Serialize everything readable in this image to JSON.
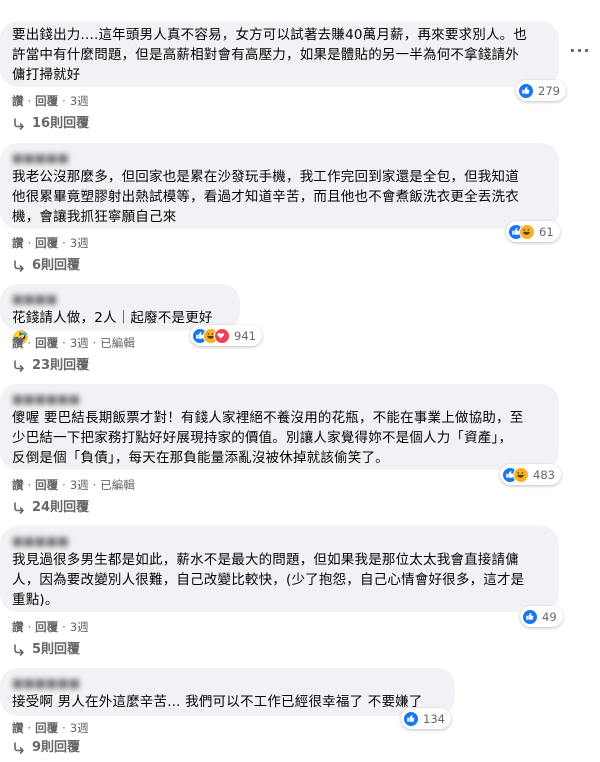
{
  "comments": [
    {
      "author": "",
      "lines": [
        "要出錢出力....這年頭男人真不容易，女方可以試著去賺40萬月薪，再來要求別人。也",
        "許當中有什麼問題，但是高薪相對會有高壓力，如果是體貼的另一半為何不拿錢請外",
        "傭打掃就好"
      ],
      "actions": [
        "讚",
        "回覆",
        "3週"
      ],
      "reaction_count": "279",
      "reaction_icons": [
        "like-icon"
      ],
      "replies": "16則回覆"
    },
    {
      "author": "",
      "lines": [
        "我老公沒那麼多，但回家也是累在沙發玩手機，我工作完回到家還是全包，但我知道",
        "他很累畢竟塑膠射出熱試模等，看過才知道辛苦，而且他也不會煮飯洗衣更全丟洗衣",
        "機，會讓我抓狂寧願自己來"
      ],
      "actions": [
        "讚",
        "回覆",
        "3週"
      ],
      "reaction_count": "61",
      "reaction_icons": [
        "like-icon",
        "haha-icon"
      ],
      "replies": "6則回覆"
    },
    {
      "author": "",
      "lines": [
        "花錢請人做，2人｜起廢不是更好🤣"
      ],
      "actions": [
        "讚",
        "回覆",
        "3週",
        "已編輯"
      ],
      "reaction_count": "941",
      "reaction_icons": [
        "like-icon",
        "haha-icon",
        "love-icon"
      ],
      "replies": "23則回覆"
    },
    {
      "author": "",
      "lines": [
        "傻喔 要巴結長期飯票才對！有錢人家裡絕不養沒用的花瓶，不能在事業上做協助，至",
        "少巴結一下把家務打點好好展現持家的價值。別讓人家覺得妳不是個人力「資產」，",
        "反倒是個「負債」，每天在那負能量添亂沒被休掉就該偷笑了。"
      ],
      "actions": [
        "讚",
        "回覆",
        "3週",
        "已編輯"
      ],
      "reaction_count": "483",
      "reaction_icons": [
        "like-icon",
        "haha-icon"
      ],
      "replies": "24則回覆"
    },
    {
      "author": "",
      "lines": [
        "我見過很多男生都是如此，薪水不是最大的問題，但如果我是那位太太我會直接請傭",
        "人，因為要改變別人很難，自己改變比較快，(少了抱怨，自己心情會好很多，這才是",
        "重點)。"
      ],
      "actions": [
        "讚",
        "回覆",
        "3週"
      ],
      "reaction_count": "49",
      "reaction_icons": [
        "like-icon"
      ],
      "replies": "5則回覆"
    },
    {
      "author": "",
      "lines": [
        "接受啊 男人在外這麼辛苦... 我們可以不工作已經很幸福了 不要嫌了"
      ],
      "actions": [
        "讚",
        "回覆",
        "3週"
      ],
      "reaction_count": "134",
      "reaction_icons": [
        "like-icon"
      ],
      "replies": "9則回覆"
    }
  ],
  "colors": {
    "bubble": "#f0f2f5",
    "secondary_text": "#65676b",
    "like": "#1877f2",
    "haha": "#f7b125",
    "love": "#f33e58"
  }
}
